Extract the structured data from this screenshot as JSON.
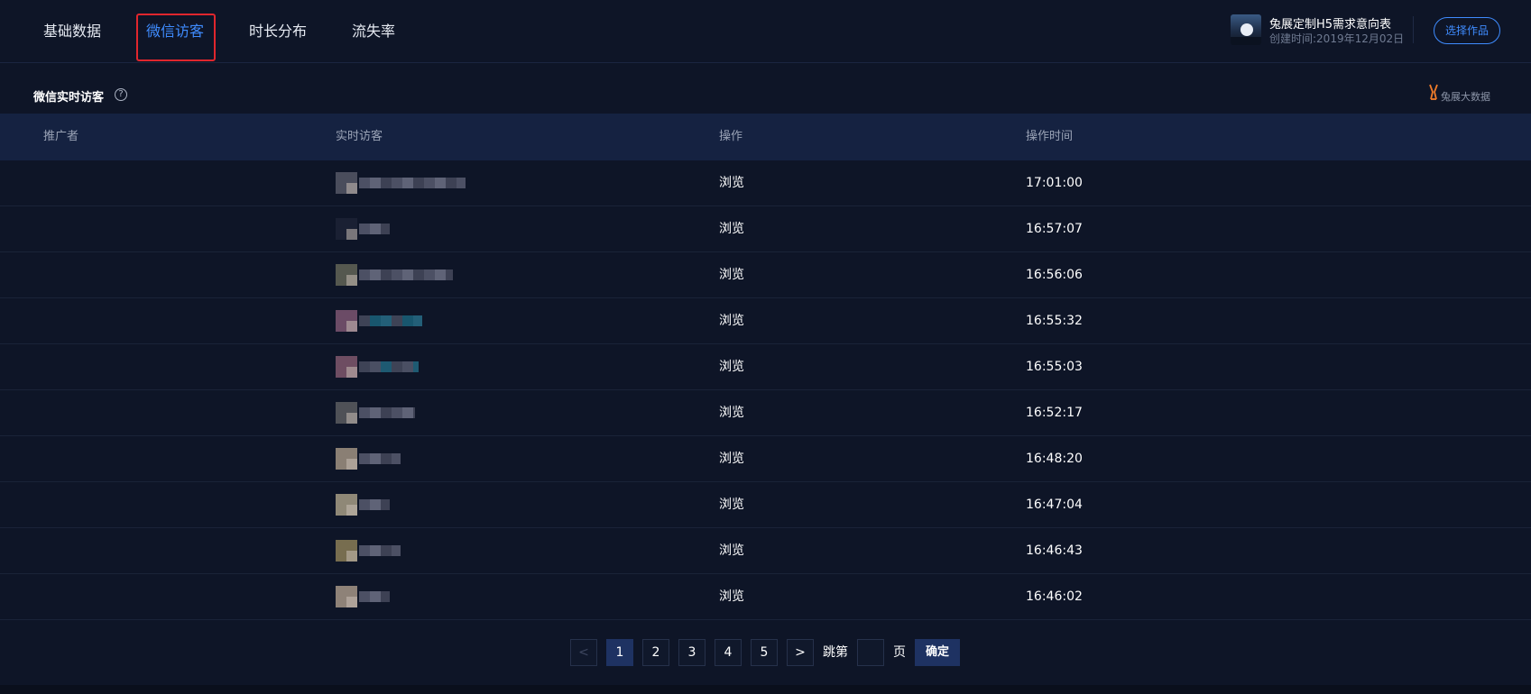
{
  "nav": {
    "tabs": [
      {
        "label": "基础数据"
      },
      {
        "label": "微信访客",
        "active": true
      },
      {
        "label": "时长分布"
      },
      {
        "label": "流失率"
      }
    ],
    "active_color": "#3f8cff",
    "highlight_color": "#e0262d"
  },
  "work": {
    "title": "兔展定制H5需求意向表",
    "created": "创建时间:2019年12月02日",
    "choose_label": "选择作品",
    "thumb_icon": "moon-night-thumbnail"
  },
  "section": {
    "title": "微信实时访客",
    "help_icon": "question-circle-icon",
    "brand_label": "兔展大数据",
    "brand_icon": "rabbit-logo-icon"
  },
  "table": {
    "headers": [
      "推广者",
      "实时访客",
      "操作",
      "操作时间"
    ],
    "rows": [
      {
        "promoter": "",
        "action": "浏览",
        "time": "17:01:00"
      },
      {
        "promoter": "",
        "action": "浏览",
        "time": "16:57:07"
      },
      {
        "promoter": "",
        "action": "浏览",
        "time": "16:56:06"
      },
      {
        "promoter": "",
        "action": "浏览",
        "time": "16:55:32"
      },
      {
        "promoter": "",
        "action": "浏览",
        "time": "16:55:03"
      },
      {
        "promoter": "",
        "action": "浏览",
        "time": "16:52:17"
      },
      {
        "promoter": "",
        "action": "浏览",
        "time": "16:48:20"
      },
      {
        "promoter": "",
        "action": "浏览",
        "time": "16:47:04"
      },
      {
        "promoter": "",
        "action": "浏览",
        "time": "16:46:43"
      },
      {
        "promoter": "",
        "action": "浏览",
        "time": "16:46:02"
      }
    ]
  },
  "pagination": {
    "prev": "<",
    "pages": [
      "1",
      "2",
      "3",
      "4",
      "5"
    ],
    "current_page": "1",
    "next": ">",
    "jump_prefix": "跳第",
    "jump_suffix": "页",
    "jump_value": "",
    "confirm_label": "确定"
  }
}
